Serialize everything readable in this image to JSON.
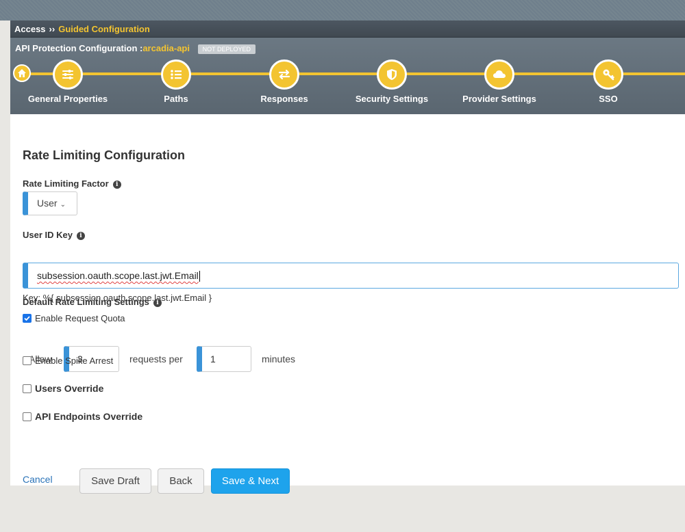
{
  "breadcrumb": {
    "root": "Access",
    "separator": "››",
    "current": "Guided Configuration"
  },
  "config": {
    "prefix": "API Protection Configuration :",
    "name": "arcadia-api",
    "status": "NOT DEPLOYED"
  },
  "steps": [
    {
      "label": "General Properties",
      "icon": "sliders-icon"
    },
    {
      "label": "Paths",
      "icon": "list-icon"
    },
    {
      "label": "Responses",
      "icon": "swap-arrows-icon"
    },
    {
      "label": "Security Settings",
      "icon": "shield-icon"
    },
    {
      "label": "Provider Settings",
      "icon": "cloud-icon"
    },
    {
      "label": "SSO",
      "icon": "key-icon"
    }
  ],
  "form": {
    "title": "Rate Limiting Configuration",
    "factor_label": "Rate Limiting Factor",
    "factor_value": "User",
    "userid_label": "User ID Key",
    "userid_value": "subsession.oauth.scope.last.jwt.Email",
    "key_hint": "Key: %{ subsession.oauth.scope.last.jwt.Email }",
    "default_label": "Default Rate Limiting Settings",
    "enable_quota": "Enable Request Quota",
    "enable_quota_checked": true,
    "allow_label": "Allow",
    "requests_value": "3",
    "requests_per_label": "requests per",
    "minutes_value": "1",
    "minutes_label": "minutes",
    "enable_spike": "Enable Spike Arrest",
    "users_override": "Users Override",
    "api_override": "API Endpoints Override"
  },
  "buttons": {
    "cancel": "Cancel",
    "save_draft": "Save Draft",
    "back": "Back",
    "save_next": "Save & Next"
  },
  "colors": {
    "accent": "#f3c431",
    "primary": "#1ea3ec",
    "input_bar": "#3a93d8"
  }
}
